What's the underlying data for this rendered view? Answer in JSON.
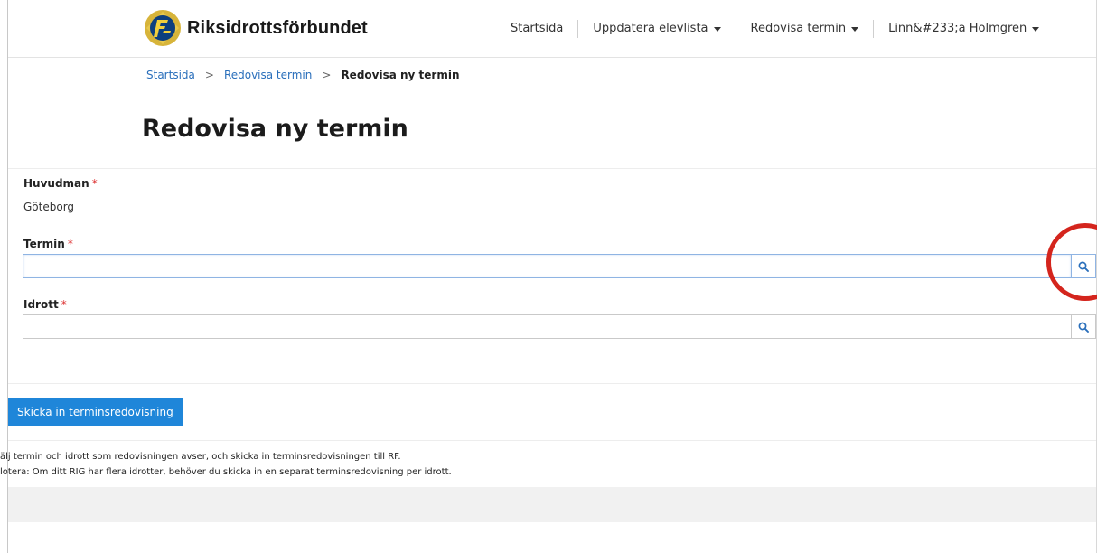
{
  "header": {
    "logo_text": "Riksidrottsförbundet",
    "nav": [
      {
        "label": "Startsida",
        "has_dropdown": false
      },
      {
        "label": "Uppdatera elevlista",
        "has_dropdown": true
      },
      {
        "label": "Redovisa termin",
        "has_dropdown": true
      },
      {
        "label": "Linn&#233;a Holmgren",
        "has_dropdown": true
      }
    ]
  },
  "breadcrumb": {
    "items": [
      "Startsida",
      "Redovisa termin"
    ],
    "separator": ">",
    "current": "Redovisa ny termin"
  },
  "page": {
    "title": "Redovisa ny termin"
  },
  "form": {
    "required_marker": "*",
    "huvudman": {
      "label": "Huvudman",
      "value": "Göteborg"
    },
    "termin": {
      "label": "Termin",
      "value": ""
    },
    "idrott": {
      "label": "Idrott",
      "value": ""
    },
    "submit_label": "Skicka in terminsredovisning"
  },
  "info": {
    "line1": "älj termin och idrott som redovisningen avser, och skicka in terminsredovisningen till RF.",
    "line2": "lotera: Om ditt RIG har flera idrotter, behöver du skicka in en separat terminsredovisning per idrott."
  },
  "colors": {
    "primary_button": "#1f86d9",
    "link": "#2a6fbb",
    "required": "#d33",
    "highlight_circle": "#d4251d"
  },
  "icons": {
    "search": "search-icon",
    "caret": "chevron-down-icon",
    "logo": "rf-logo-icon"
  }
}
